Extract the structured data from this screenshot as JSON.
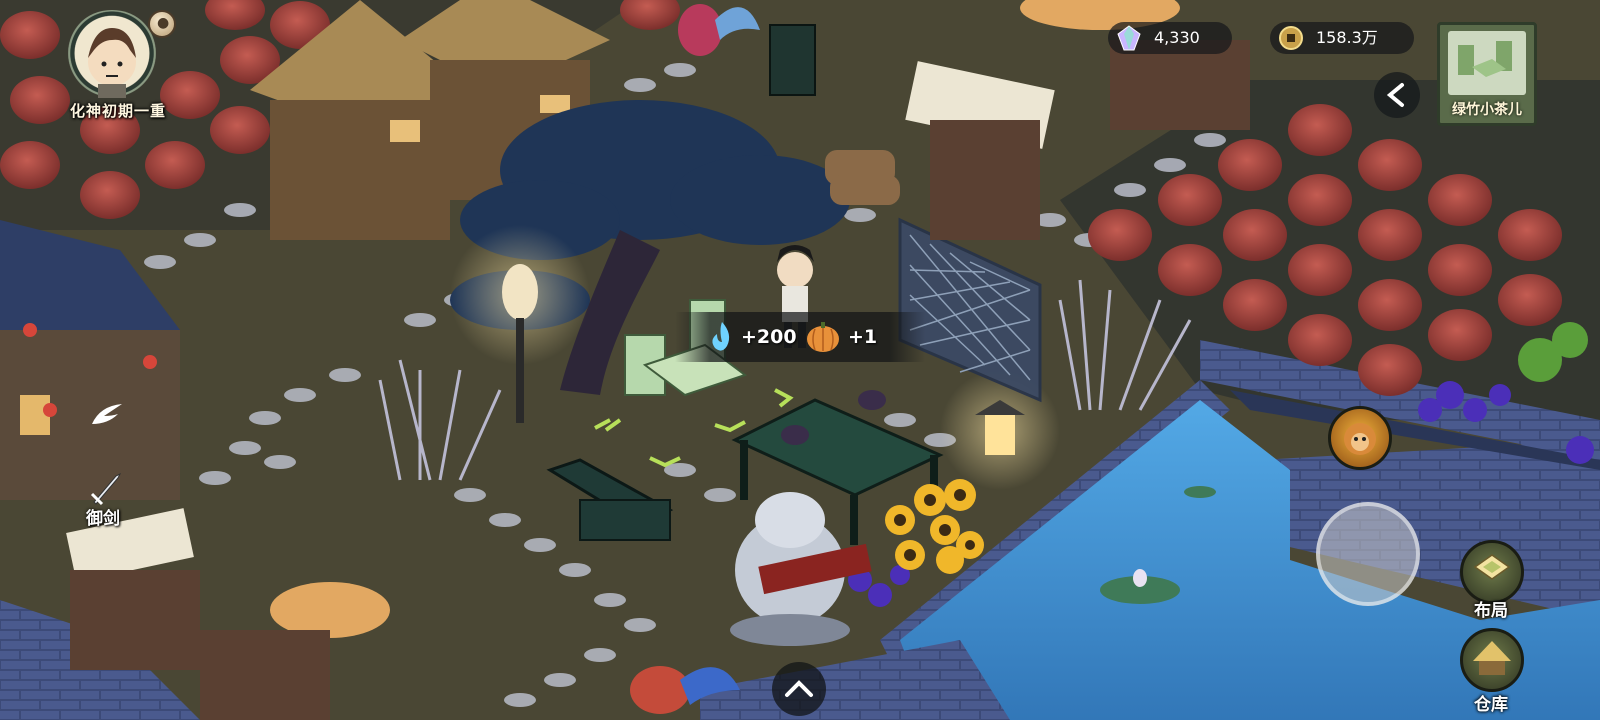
{
  "player": {
    "realm": "化神初期一重"
  },
  "currencies": {
    "gems": "4,330",
    "coins": "158.3万"
  },
  "selected_item": {
    "name": "绿竹小茶儿"
  },
  "reward_popup": {
    "spirit_gain": "+200",
    "pumpkin_gain": "+1"
  },
  "left_menu": {
    "sword_label": "御剑"
  },
  "right_menu": {
    "layout_label": "布局",
    "storage_label": "仓库"
  },
  "icons": {
    "avatar": "avatar-icon",
    "bell": "bell-icon",
    "gem": "gem-icon",
    "coin": "coin-icon",
    "collapse": "chevron-left-icon",
    "spirit": "spirit-flame-icon",
    "pumpkin": "pumpkin-icon",
    "feather": "feather-icon",
    "sword": "sword-icon",
    "monkey": "monkey-king-icon",
    "layout": "layout-icon",
    "storage": "straw-hut-icon",
    "up": "chevron-up-icon"
  },
  "colors": {
    "ground": "#4a4734",
    "water": "#3f8fcf",
    "pumpkin": "#a5463f",
    "hud_dark": "#16181a",
    "accent_green": "#b7e05a"
  }
}
